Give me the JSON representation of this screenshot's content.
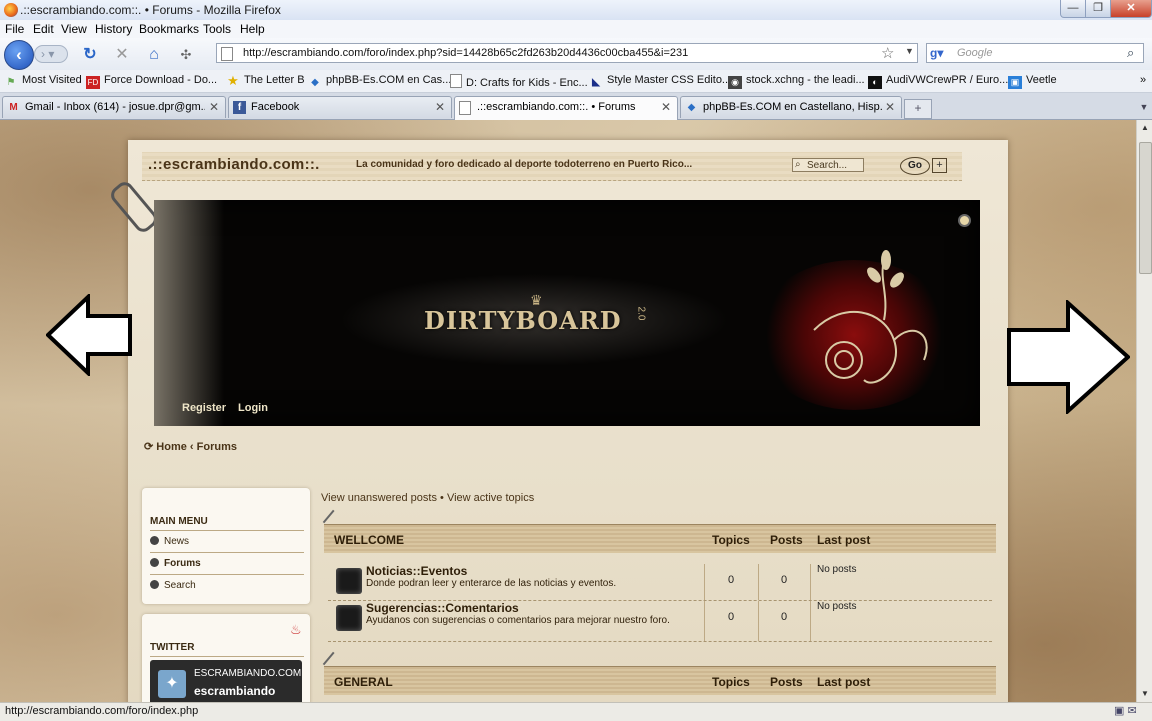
{
  "window": {
    "title": ".::escrambiando.com::. • Forums - Mozilla Firefox",
    "minimize_glyph": "—",
    "maximize_glyph": "❐",
    "close_glyph": "✕"
  },
  "menu": [
    "File",
    "Edit",
    "View",
    "History",
    "Bookmarks",
    "Tools",
    "Help"
  ],
  "nav": {
    "url": "http://escrambiando.com/foro/index.php?sid=14428b65c2fd263b20d4436c00cba455&i=231",
    "search_placeholder": "Google"
  },
  "bookmarks": [
    {
      "label": "Most Visited",
      "icon": "most-visited-icon"
    },
    {
      "label": "Force Download - Do...",
      "icon": "fd-icon"
    },
    {
      "label": "The Letter B",
      "icon": "star-icon"
    },
    {
      "label": "phpBB-Es.COM en Cas...",
      "icon": "phpbb-icon"
    },
    {
      "label": "D: Crafts for Kids - Enc...",
      "icon": "page-icon"
    },
    {
      "label": "Style Master CSS Edito...",
      "icon": "stylemaster-icon"
    },
    {
      "label": "stock.xchng - the leadi...",
      "icon": "camera-icon"
    },
    {
      "label": "AudiVWCrewPR / Euro...",
      "icon": "audi-icon"
    },
    {
      "label": "Veetle",
      "icon": "tv-icon"
    }
  ],
  "tabs": [
    {
      "label": "Gmail - Inbox (614) - josue.dpr@gm...",
      "icon": "gmail-icon",
      "active": false
    },
    {
      "label": "Facebook",
      "icon": "facebook-icon",
      "active": false
    },
    {
      "label": ".::escrambiando.com::. • Forums",
      "icon": "page-icon",
      "active": true
    },
    {
      "label": "phpBB-Es.COM en Castellano, Hisp...",
      "icon": "phpbb-icon",
      "active": false
    }
  ],
  "site": {
    "title": ".::escrambiando.com::.",
    "description": "La comunidad y foro dedicado al deporte todoterreno en Puerto Rico...",
    "search_label": "Search...",
    "go_label": "Go",
    "plus_label": "+",
    "banner_logo": "DIRTYBOARD",
    "banner_version": "2.0",
    "register": "Register",
    "login": "Login",
    "breadcrumb_home": "Home",
    "breadcrumb_sep": "‹",
    "breadcrumb_forums": "Forums"
  },
  "sidebar": {
    "main_menu_title": "MAIN MENU",
    "items": [
      "News",
      "Forums",
      "Search"
    ],
    "twitter_title": "TWITTER",
    "twitter_handle_upper": "ESCRAMBIANDO.COM",
    "twitter_handle": "escrambiando"
  },
  "forum": {
    "unanswered": "View unanswered posts",
    "sep": "•",
    "active": "View active topics",
    "headers": {
      "topics": "Topics",
      "posts": "Posts",
      "last_post": "Last post"
    },
    "categories": [
      {
        "name": "WELLCOME",
        "forums": [
          {
            "name": "Noticias::Eventos",
            "desc": "Donde podran leer y enterarce de las noticias y eventos.",
            "topics": "0",
            "posts": "0",
            "last_post": "No posts"
          },
          {
            "name": "Sugerencias::Comentarios",
            "desc": "Ayudanos con sugerencias o comentarios para mejorar nuestro foro.",
            "topics": "0",
            "posts": "0",
            "last_post": "No posts"
          }
        ]
      },
      {
        "name": "GENERAL",
        "forums": []
      }
    ]
  },
  "status": {
    "text": "http://escrambiando.com/foro/index.php"
  }
}
